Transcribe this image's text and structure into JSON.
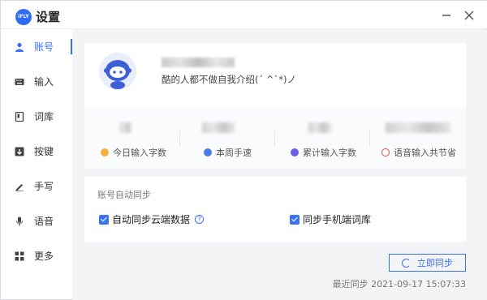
{
  "window": {
    "logo_text": "iFLY",
    "title": "设置"
  },
  "sidebar": {
    "items": [
      {
        "label": "账号",
        "icon": "user-icon",
        "active": true
      },
      {
        "label": "输入",
        "icon": "keyboard-icon",
        "active": false
      },
      {
        "label": "词库",
        "icon": "book-icon",
        "active": false
      },
      {
        "label": "按键",
        "icon": "key-icon",
        "active": false
      },
      {
        "label": "手写",
        "icon": "pen-icon",
        "active": false
      },
      {
        "label": "语音",
        "icon": "mic-icon",
        "active": false
      },
      {
        "label": "更多",
        "icon": "grid-icon",
        "active": false
      }
    ]
  },
  "profile": {
    "bio": "酷的人都不做自我介绍(´ ^`*)ノ",
    "stats": [
      {
        "label": "今日输入字数",
        "icon": "coin-icon",
        "color": "#f5b041"
      },
      {
        "label": "本周手速",
        "icon": "speed-icon",
        "color": "#4b7bec"
      },
      {
        "label": "累计输入字数",
        "icon": "chart-icon",
        "color": "#6c5ce7"
      },
      {
        "label": "语音输入共节省",
        "icon": "clock-icon",
        "color": "#e74c3c"
      }
    ]
  },
  "sync": {
    "title": "账号自动同步",
    "auto_cloud": "自动同步云端数据",
    "phone_lexicon": "同步手机端词库",
    "button": "立即同步",
    "last_sync": "最近同步 2021-09-17 15:07:33"
  },
  "colors": {
    "accent": "#3a72f2"
  }
}
